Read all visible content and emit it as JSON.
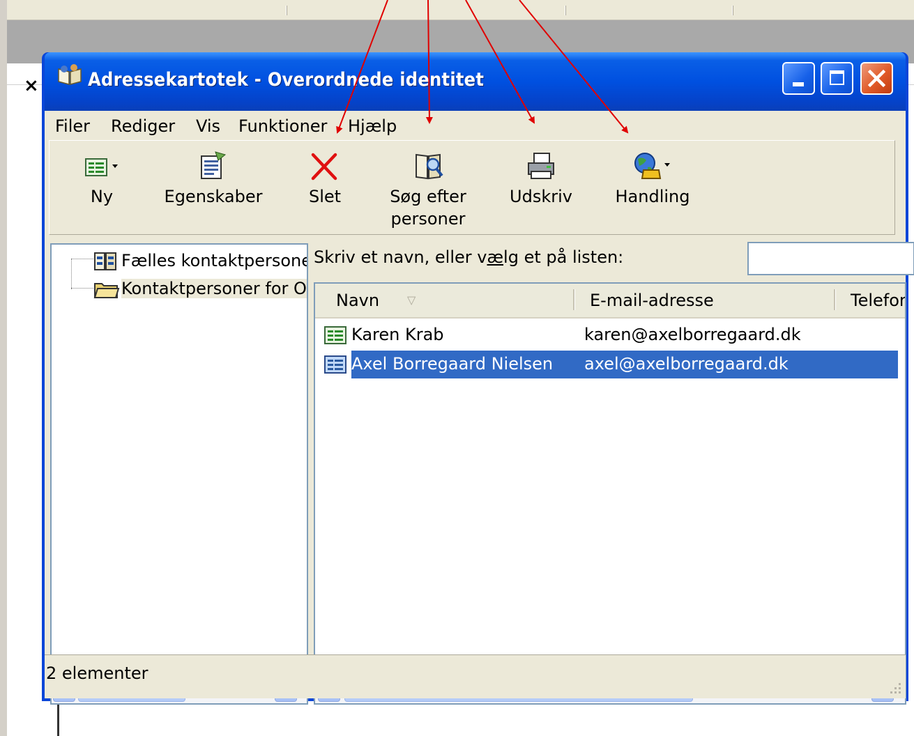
{
  "background": {
    "close_glyph": "×"
  },
  "window": {
    "title": "Adressekartotek - Overordnede identitet",
    "icon": "address-book-icon",
    "controls": [
      "minimize",
      "maximize",
      "close"
    ]
  },
  "menu": [
    "Filer",
    "Rediger",
    "Vis",
    "Funktioner",
    "Hjælp"
  ],
  "toolbar": {
    "new": "Ny",
    "properties": "Egenskaber",
    "delete": "Slet",
    "find_line1": "Søg efter",
    "find_line2": "personer",
    "print": "Udskriv",
    "action": "Handling"
  },
  "tree": {
    "items": [
      {
        "label": "Fælles kontaktpersoner",
        "icon": "shared-contacts-icon"
      },
      {
        "label": "Kontaktpersoner for Overordnede identitet",
        "icon": "folder-icon",
        "selected": true
      }
    ]
  },
  "prompt": {
    "before": "Skriv et navn, eller v",
    "underlined": "æ",
    "after": "lg et på listen:"
  },
  "list": {
    "columns": [
      "Navn",
      "E-mail-adresse",
      "Telefon"
    ],
    "rows": [
      {
        "name": "Karen Krab",
        "email": "karen@axelborregaard.dk",
        "selected": false
      },
      {
        "name": "Axel Borregaard Nielsen",
        "email": "axel@axelborregaard.dk",
        "selected": true
      }
    ]
  },
  "status": {
    "text": "2 elementer"
  },
  "colors": {
    "titlebar": "#0054e3",
    "selection": "#316ac5",
    "annotation_arrow": "#e00000",
    "close_button": "#e05a28"
  }
}
